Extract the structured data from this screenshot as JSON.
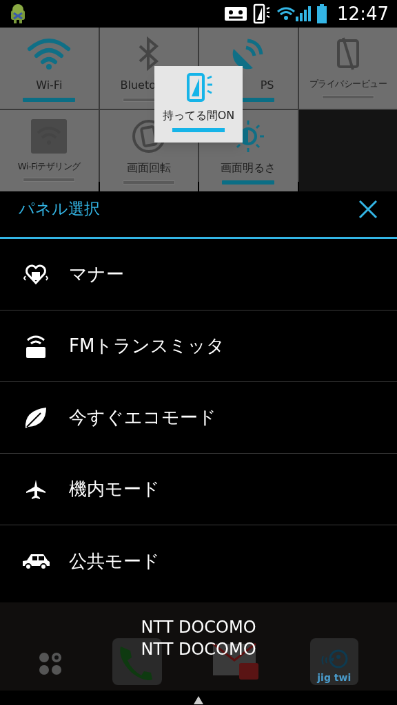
{
  "status_bar": {
    "time": "12:47"
  },
  "quick_tiles": [
    {
      "kind": "wifi",
      "label": "Wi-Fi",
      "on": true
    },
    {
      "kind": "bluetooth",
      "label": "Blueto",
      "on": false
    },
    {
      "kind": "gps",
      "label": "PS",
      "on": true
    },
    {
      "kind": "privacy",
      "label": "プライバシービュー",
      "on": false
    },
    {
      "kind": "tethering",
      "label": "Wi-Fiテザリング",
      "on": false
    },
    {
      "kind": "rotation",
      "label": "画面回転",
      "on": false
    },
    {
      "kind": "brightness",
      "label": "画面明るさ",
      "on": true
    },
    {
      "kind": "empty"
    }
  ],
  "popup": {
    "label": "持ってる間ON",
    "on": true
  },
  "panel": {
    "title": "パネル選択",
    "items": [
      {
        "kind": "manner",
        "label": "マナー"
      },
      {
        "kind": "fm",
        "label": "FMトランスミッタ"
      },
      {
        "kind": "eco",
        "label": "今すぐエコモード"
      },
      {
        "kind": "plane",
        "label": "機内モード"
      },
      {
        "kind": "car",
        "label": "公共モード"
      }
    ]
  },
  "carrier": [
    "NTT DOCOMO",
    "NTT DOCOMO"
  ],
  "dock": {
    "app_label": "jig twi"
  }
}
